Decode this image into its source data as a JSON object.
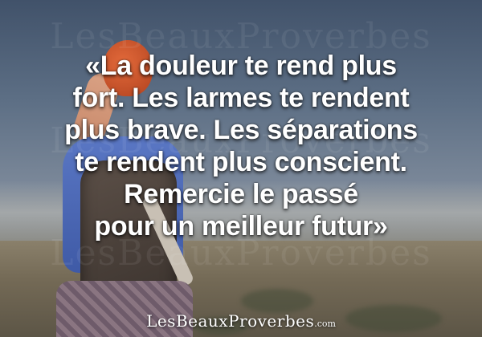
{
  "watermark": {
    "text": "LesBeauxProverbes"
  },
  "quote": {
    "lines": [
      "«La douleur te rend plus",
      "fort. Les larmes te rendent",
      "plus brave. Les séparations",
      "te rendent plus conscient.",
      "Remercie le passé",
      "pour un meilleur futur»"
    ]
  },
  "brand": {
    "name": "LesBeauxProverbes",
    "suffix": ".com"
  },
  "colors": {
    "text": "#ffffff",
    "sky": "#41526a",
    "hair": "#e2693a",
    "shirt": "#4a66b5"
  }
}
